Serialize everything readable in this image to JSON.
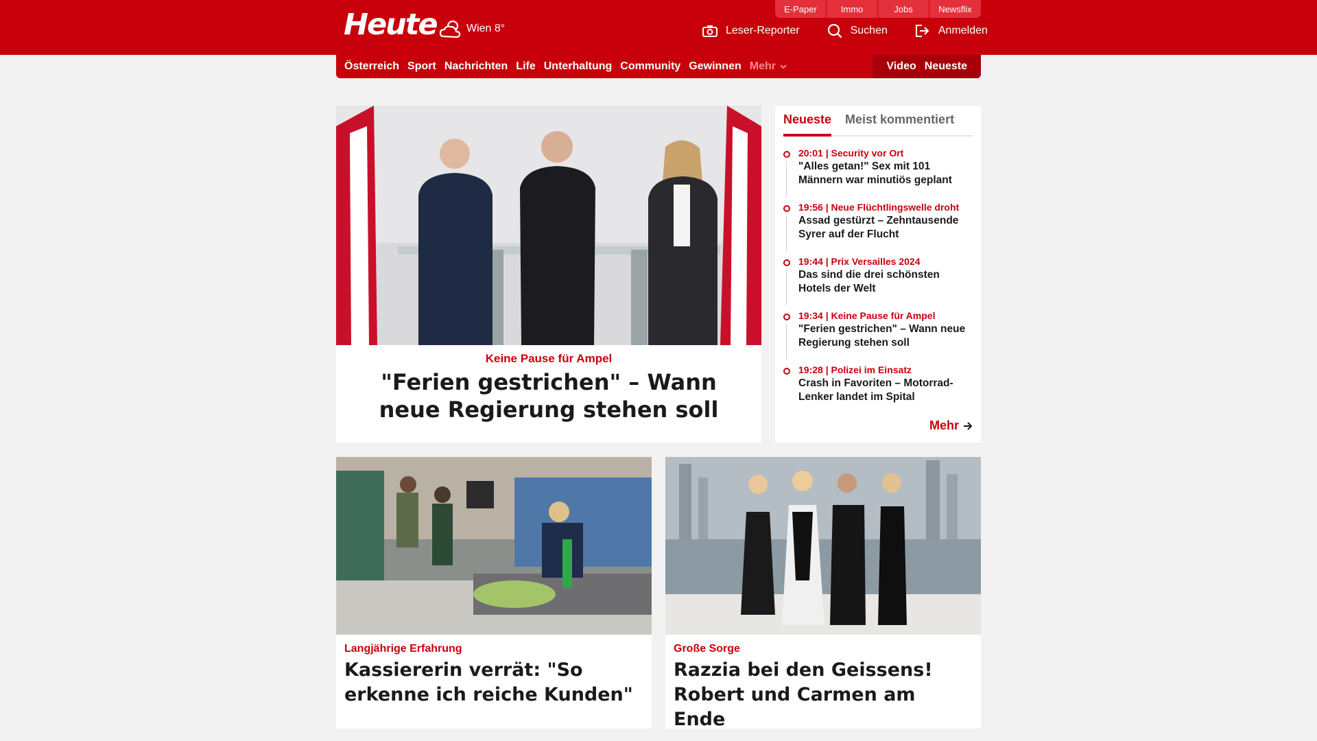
{
  "header": {
    "logo": "Heute",
    "weather": "Wien 8°",
    "quick_links": [
      "E-Paper",
      "Immo",
      "Jobs",
      "Newsflix"
    ],
    "actions": {
      "reporter": "Leser-Reporter",
      "search": "Suchen",
      "login": "Anmelden"
    }
  },
  "nav": {
    "items": [
      "Österreich",
      "Sport",
      "Nachrichten",
      "Life",
      "Unterhaltung",
      "Community",
      "Gewinnen"
    ],
    "more": "Mehr",
    "right": [
      "Video",
      "Neueste"
    ]
  },
  "hero": {
    "kicker": "Keine Pause für Ampel",
    "title": "\"Ferien gestrichen\" – Wann neue Regierung stehen soll"
  },
  "panel": {
    "tabs": [
      "Neueste",
      "Meist kommentiert"
    ],
    "items": [
      {
        "meta": "20:01 | Security vor Ort",
        "title": "\"Alles getan!\" Sex mit 101 Männern war minutiös geplant"
      },
      {
        "meta": "19:56 | Neue Flüchtlingswelle droht",
        "title": "Assad gestürzt – Zehntausende Syrer auf der Flucht"
      },
      {
        "meta": "19:44 | Prix Versailles 2024",
        "title": "Das sind die drei schönsten Hotels der Welt"
      },
      {
        "meta": "19:34 | Keine Pause für Ampel",
        "title": "\"Ferien gestrichen\" – Wann neue Regierung stehen soll"
      },
      {
        "meta": "19:28 | Polizei im Einsatz",
        "title": "Crash in Favoriten – Motorrad-Lenker landet im Spital"
      }
    ],
    "more": "Mehr"
  },
  "cards": [
    {
      "kicker": "Langjährige Erfahrung",
      "title": "Kassiererin verrät: \"So erkenne ich reiche Kunden\""
    },
    {
      "kicker": "Große Sorge",
      "title": "Razzia bei den Geissens! Robert und Carmen am Ende"
    }
  ],
  "colors": {
    "brand": "#c8000b",
    "brand_dark": "#a8000a",
    "background": "#f2f2f2"
  }
}
